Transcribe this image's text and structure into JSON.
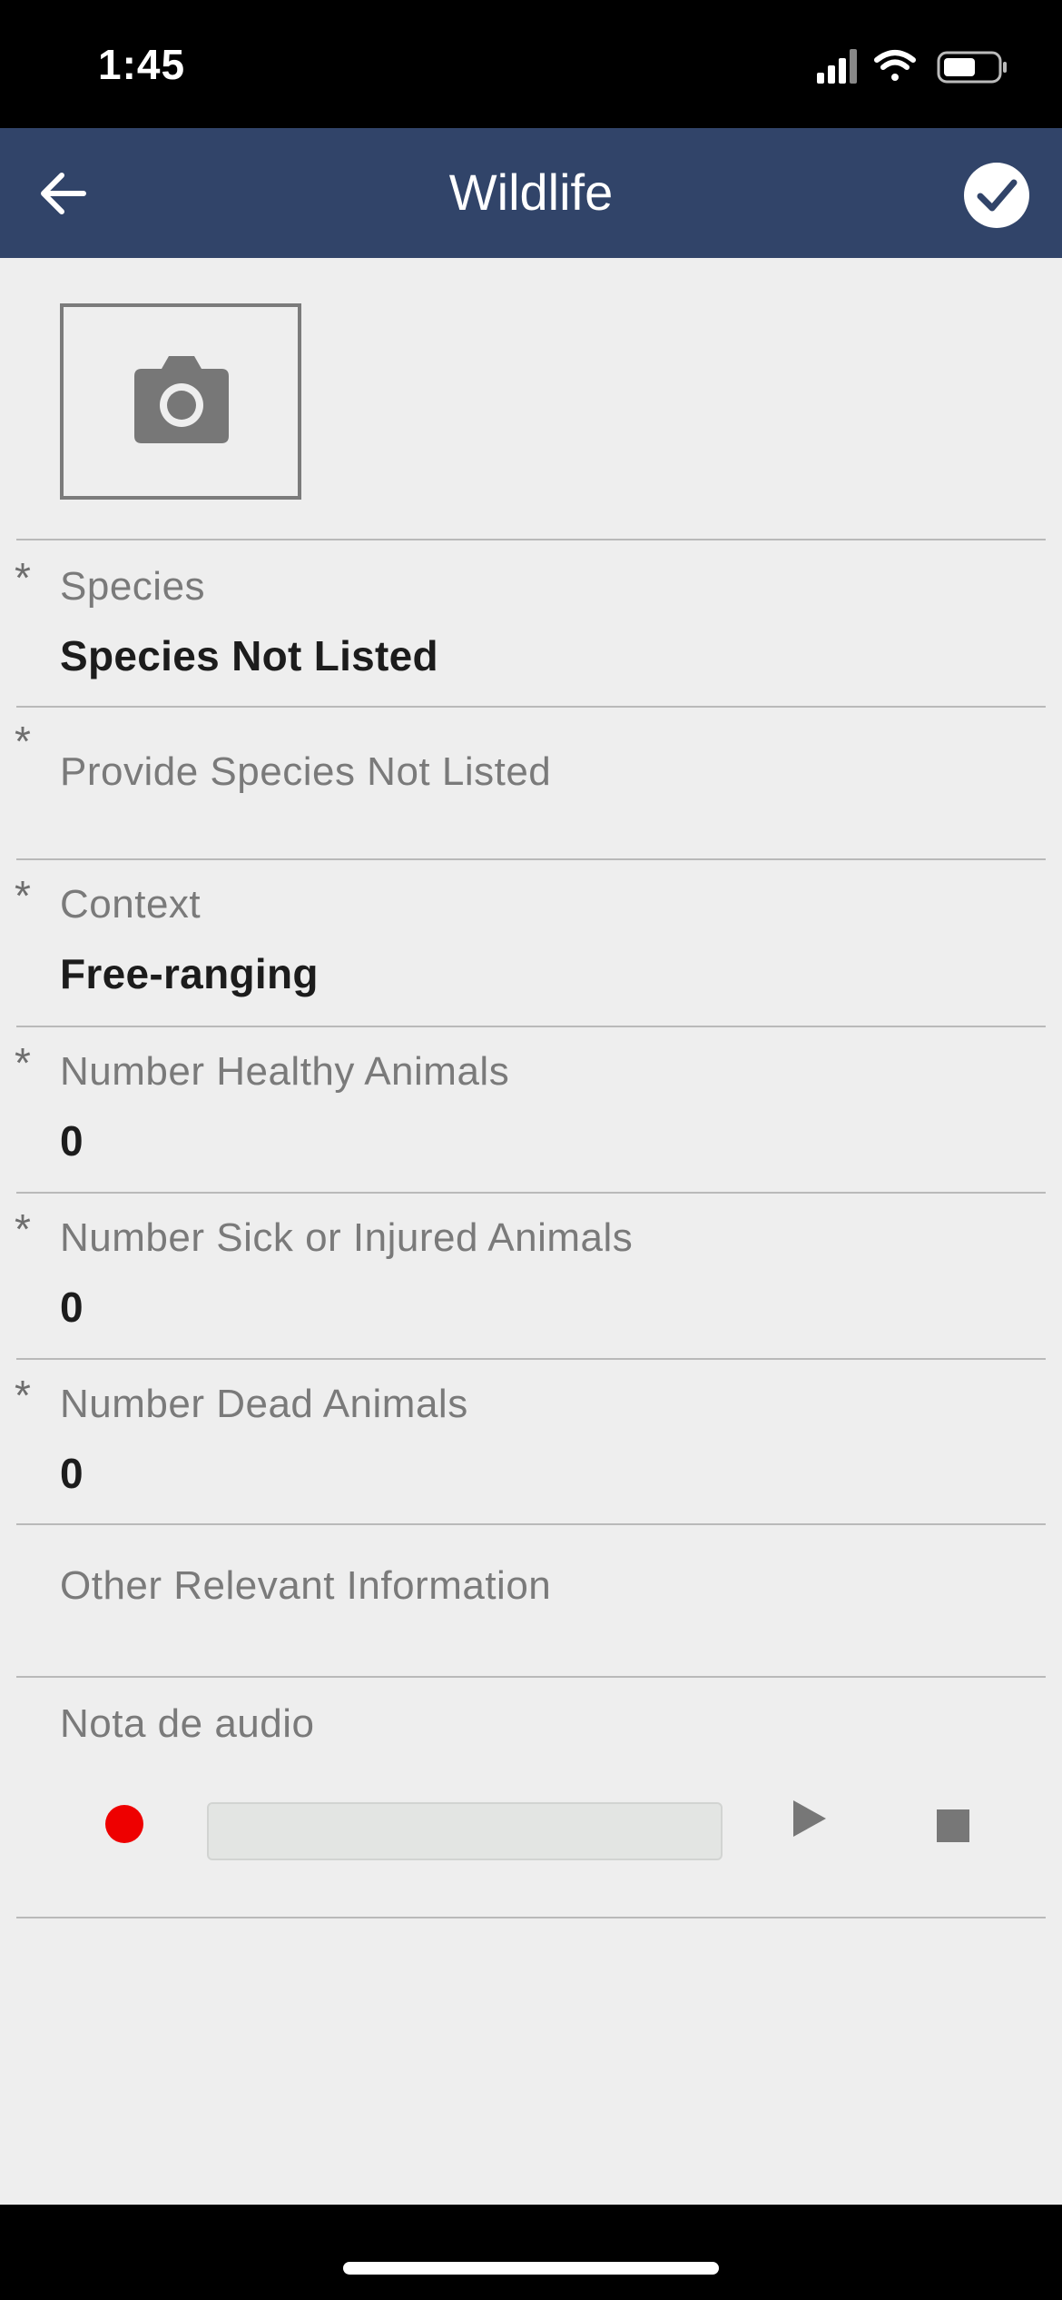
{
  "status_bar": {
    "time": "1:45"
  },
  "header": {
    "title": "Wildlife",
    "back_icon": "arrow-left-icon",
    "confirm_icon": "check-circle-icon"
  },
  "photo": {
    "icon": "camera-icon"
  },
  "fields": [
    {
      "label": "Species",
      "value": "Species Not Listed",
      "required": "*"
    },
    {
      "label": "Provide Species Not Listed",
      "value": "",
      "required": "*"
    },
    {
      "label": "Context",
      "value": "Free-ranging",
      "required": "*"
    },
    {
      "label": "Number Healthy Animals",
      "value": "0",
      "required": "*"
    },
    {
      "label": "Number Sick or Injured Animals",
      "value": "0",
      "required": "*"
    },
    {
      "label": "Number Dead Animals",
      "value": "0",
      "required": "*"
    },
    {
      "label": "Other Relevant Information",
      "value": ""
    }
  ],
  "audio": {
    "label": "Nota de audio",
    "record_color": "#ee0000"
  },
  "colors": {
    "header_bg": "#314469",
    "page_bg": "#eeeeee"
  }
}
